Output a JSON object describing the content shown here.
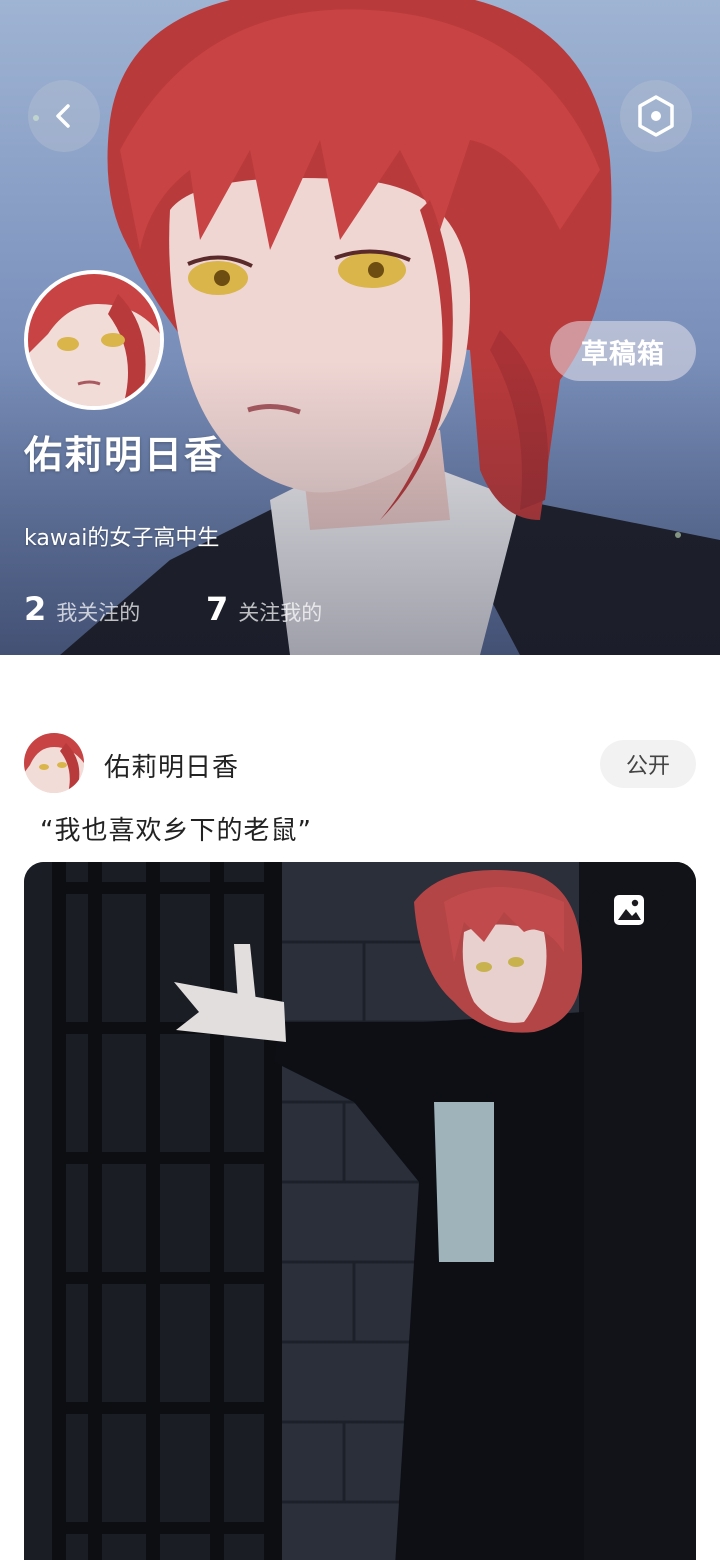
{
  "header": {
    "back_icon": "chevron-left-icon",
    "settings_icon": "hexagon-settings-icon",
    "drafts_label": "草稿箱"
  },
  "profile": {
    "name": "佑莉明日香",
    "bio": "kawai的女子高中生",
    "stats": {
      "following_count": "2",
      "following_label": "我关注的",
      "followers_count": "7",
      "followers_label": "关注我的"
    }
  },
  "post": {
    "author_name": "佑莉明日香",
    "visibility": "公开",
    "text": "“我也喜欢乡下的老鼠”",
    "image_badge_icon": "image-icon"
  },
  "colors": {
    "hair": "#c9403f",
    "cover_sky": "#8fa3c8",
    "pill_bg": "#f2f2f2"
  }
}
